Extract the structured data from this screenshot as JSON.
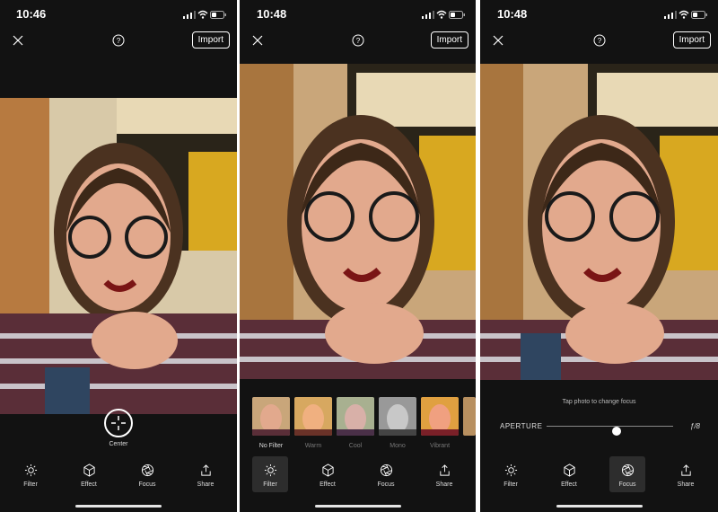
{
  "screens": [
    {
      "time": "10:46",
      "import_label": "Import",
      "center_label": "Center",
      "tools": [
        "Filter",
        "Effect",
        "Focus",
        "Share"
      ]
    },
    {
      "time": "10:48",
      "import_label": "Import",
      "filters": [
        "No Filter",
        "Warm",
        "Cool",
        "Mono",
        "Vibrant"
      ],
      "selected_filter": "No Filter",
      "selected_tool": "Filter",
      "tools": [
        "Filter",
        "Effect",
        "Focus",
        "Share"
      ]
    },
    {
      "time": "10:48",
      "import_label": "Import",
      "focus_hint": "Tap photo to change focus",
      "aperture_label": "APERTURE",
      "aperture_value": "ƒ/8",
      "aperture_level": 0.55,
      "selected_tool": "Focus",
      "tools": [
        "Filter",
        "Effect",
        "Focus",
        "Share"
      ]
    }
  ],
  "icons": {
    "close": "close-icon",
    "help": "help-icon",
    "filter": "sun-icon",
    "effect": "cube-icon",
    "focus": "aperture-icon",
    "share": "share-icon"
  },
  "colors": {
    "background": "#121212",
    "text": "#ffffff",
    "selected_tool_bg": "#2d2d2d"
  }
}
